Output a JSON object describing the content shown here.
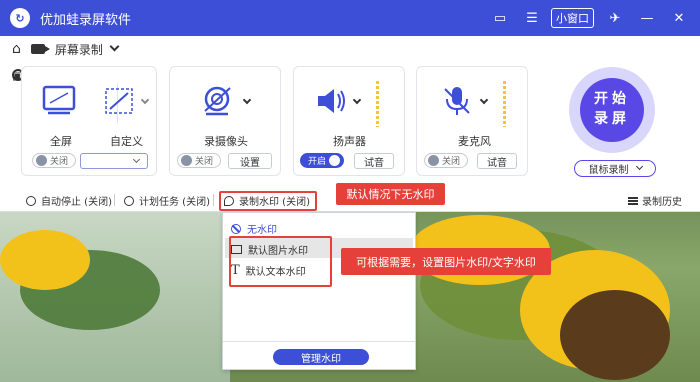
{
  "app": {
    "title": "优加蛙录屏软件",
    "mini_window_label": "小窗口"
  },
  "toolbar": {
    "mode_label": "屏幕录制",
    "settings_label": "设置"
  },
  "panels": {
    "screen": {
      "fullscreen_label": "全屏",
      "custom_label": "自定义",
      "toggle_label": "关闭"
    },
    "camera": {
      "label": "录摄像头",
      "toggle_label": "关闭",
      "settings_label": "设置"
    },
    "speaker": {
      "label": "扬声器",
      "toggle_label": "开启",
      "test_label": "试音"
    },
    "mic": {
      "label": "麦克风",
      "toggle_label": "关闭",
      "test_label": "试音"
    }
  },
  "record": {
    "start_label": "开始录屏",
    "mode_label": "鼠标录制"
  },
  "status": {
    "auto_stop": "自动停止 (关闭)",
    "schedule": "计划任务 (关闭)",
    "watermark": "录制水印 (关闭)",
    "history": "录制历史"
  },
  "callouts": {
    "default": "默认情况下无水印",
    "options": "可根据需要，设置图片水印/文字水印"
  },
  "watermark_menu": {
    "none": "无水印",
    "image": "默认图片水印",
    "text": "默认文本水印",
    "manage": "管理水印"
  },
  "colors": {
    "brand": "#3d4fd6",
    "record": "#5a48e6",
    "annotation": "#e5413a"
  }
}
